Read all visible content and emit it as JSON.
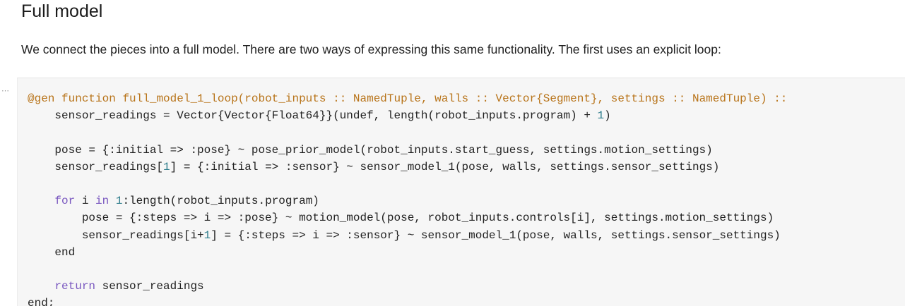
{
  "section": {
    "title": "Full model",
    "description": "We connect the pieces into a full model. There are two ways of expressing this same functionality. The first uses an explicit loop:"
  },
  "cell": {
    "handle": "⋯"
  },
  "code": {
    "lines": [
      {
        "id": "l1",
        "tokens": [
          {
            "t": "@gen",
            "c": "mac"
          },
          {
            "t": " ",
            "c": ""
          },
          {
            "t": "function",
            "c": "mac"
          },
          {
            "t": " ",
            "c": ""
          },
          {
            "t": "full_model_1_loop(robot_inputs :: NamedTuple, walls :: Vector{Segment}, settings :: NamedTuple) ::",
            "c": "ty"
          }
        ]
      },
      {
        "id": "l2",
        "tokens": [
          {
            "t": "    sensor_readings = Vector{Vector{Float64}}(undef, length(robot_inputs.program) + ",
            "c": ""
          },
          {
            "t": "1",
            "c": "num"
          },
          {
            "t": ")",
            "c": ""
          }
        ]
      },
      {
        "id": "l3",
        "tokens": []
      },
      {
        "id": "l4",
        "tokens": [
          {
            "t": "    pose = {:initial => :pose} ~ pose_prior_model(robot_inputs.start_guess, settings.motion_settings)",
            "c": ""
          }
        ]
      },
      {
        "id": "l5",
        "tokens": [
          {
            "t": "    sensor_readings[",
            "c": ""
          },
          {
            "t": "1",
            "c": "num"
          },
          {
            "t": "] = {:initial => :sensor} ~ sensor_model_1(pose, walls, settings.sensor_settings)",
            "c": ""
          }
        ]
      },
      {
        "id": "l6",
        "tokens": []
      },
      {
        "id": "l7",
        "tokens": [
          {
            "t": "    ",
            "c": ""
          },
          {
            "t": "for",
            "c": "kw"
          },
          {
            "t": " i ",
            "c": ""
          },
          {
            "t": "in",
            "c": "kw"
          },
          {
            "t": " ",
            "c": ""
          },
          {
            "t": "1",
            "c": "num"
          },
          {
            "t": ":length(robot_inputs.program)",
            "c": ""
          }
        ]
      },
      {
        "id": "l8",
        "tokens": [
          {
            "t": "        pose = {:steps => i => :pose} ~ motion_model(pose, robot_inputs.controls[i], settings.motion_settings)",
            "c": ""
          }
        ]
      },
      {
        "id": "l9",
        "tokens": [
          {
            "t": "        sensor_readings[i+",
            "c": ""
          },
          {
            "t": "1",
            "c": "num"
          },
          {
            "t": "] = {:steps => i => :sensor} ~ sensor_model_1(pose, walls, settings.sensor_settings)",
            "c": ""
          }
        ]
      },
      {
        "id": "l10",
        "tokens": [
          {
            "t": "    end",
            "c": ""
          }
        ]
      },
      {
        "id": "l11",
        "tokens": []
      },
      {
        "id": "l12",
        "tokens": [
          {
            "t": "    ",
            "c": ""
          },
          {
            "t": "return",
            "c": "kw"
          },
          {
            "t": " sensor_readings",
            "c": ""
          }
        ]
      },
      {
        "id": "l13",
        "tokens": [
          {
            "t": "end;",
            "c": ""
          }
        ]
      }
    ]
  },
  "colors": {
    "keyword": "#7a58c0",
    "macro": "#b8741a",
    "number": "#2e7d8c",
    "cell_background": "#f6f6f6"
  }
}
